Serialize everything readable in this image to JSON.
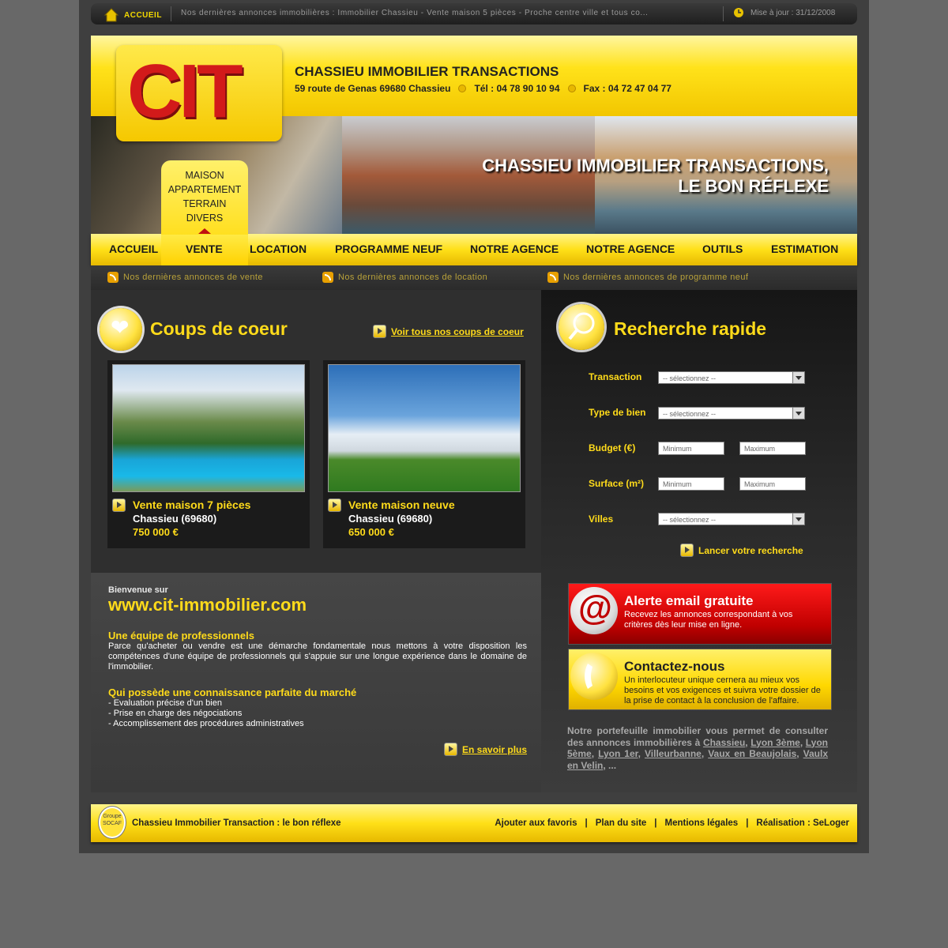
{
  "topbar": {
    "home_label": "ACCUEIL",
    "ticker": "Nos dernières annonces immobilières : Immobilier Chassieu - Vente maison 5 pièces - Proche centre ville et tous co...",
    "update": "Mise à jour : 31/12/2008"
  },
  "header": {
    "logo_text": "CIT",
    "company": "CHASSIEU IMMOBILIER TRANSACTIONS",
    "address": "59 route de Genas 69680 Chassieu",
    "tel": "Tél : 04 78 90 10 94",
    "fax": "Fax : 04 72 47 04 77",
    "slogan_line1": "CHASSIEU IMMOBILIER TRANSACTIONS,",
    "slogan_line2": "LE BON RÉFLEXE"
  },
  "sales_menu": [
    "MAISON",
    "APPARTEMENT",
    "TERRAIN",
    "DIVERS"
  ],
  "nav": [
    "ACCUEIL",
    "VENTE",
    "LOCATION",
    "PROGRAMME NEUF",
    "NOTRE AGENCE",
    "NOTRE AGENCE",
    "OUTILS",
    "ESTIMATION"
  ],
  "rss": [
    "Nos dernières annonces de vente",
    "Nos dernières annonces de location",
    "Nos dernières annonces de programme neuf"
  ],
  "favorites": {
    "title": "Coups de coeur",
    "see_all": "Voir tous nos coups de coeur",
    "cards": [
      {
        "title": "Vente maison 7 pièces",
        "city": "Chassieu (69680)",
        "price": "750 000 €"
      },
      {
        "title": "Vente maison neuve",
        "city": "Chassieu (69680)",
        "price": "650 000 €"
      }
    ]
  },
  "search": {
    "title": "Recherche rapide",
    "transaction_label": "Transaction",
    "type_label": "Type de bien",
    "budget_label": "Budget (€)",
    "surface_label": "Surface (m²)",
    "cities_label": "Villes",
    "select_placeholder": "-- sélectionnez --",
    "min_placeholder": "Minimum",
    "max_placeholder": "Maximum",
    "submit": "Lancer votre recherche"
  },
  "welcome": {
    "intro": "Bienvenue sur",
    "site": "www.cit-immobilier.com",
    "h1": "Une équipe de professionnels",
    "p1": "Parce qu'acheter ou vendre est une démarche fondamentale nous mettons à votre disposition les compétences d'une équipe de professionnels qui s'appuie sur une longue expérience dans le domaine de l'immobilier.",
    "h2": "Qui possède une connaissance parfaite du marché",
    "list": [
      "- Evaluation précise d'un bien",
      "- Prise en charge des négociations",
      "- Accomplissement des procédures administratives"
    ],
    "more": "En savoir plus"
  },
  "alert": {
    "title": "Alerte email gratuite",
    "desc": "Recevez les annonces correspondant à vos critères dès leur mise en ligne."
  },
  "contact": {
    "title": "Contactez-nous",
    "desc": "Un interlocuteur unique cernera au mieux vos besoins et vos exigences et suivra votre dossier de la prise de contact à la conclusion de l'affaire."
  },
  "portfolio": {
    "text": "Notre portefeuille immobilier vous permet de consulter des annonces immobilières à",
    "cities": [
      "Chassieu",
      "Lyon 3ème",
      "Lyon 5ème",
      "Lyon 1er",
      "Villeurbanne",
      "Vaux en Beaujolais",
      "Vaulx en Velin"
    ],
    "ellipsis": "..."
  },
  "footer": {
    "seal_text": "Groupe SOCAF",
    "slogan": "Chassieu Immobilier Transaction : le bon réflexe",
    "links": [
      "Ajouter aux favoris",
      "|",
      "Plan du site",
      "|",
      "Mentions légales",
      "|",
      "Réalisation : SeLoger"
    ]
  },
  "colors": {
    "accent": "#ffdb1a",
    "alert_red": "#d00000",
    "background": "#686868"
  }
}
